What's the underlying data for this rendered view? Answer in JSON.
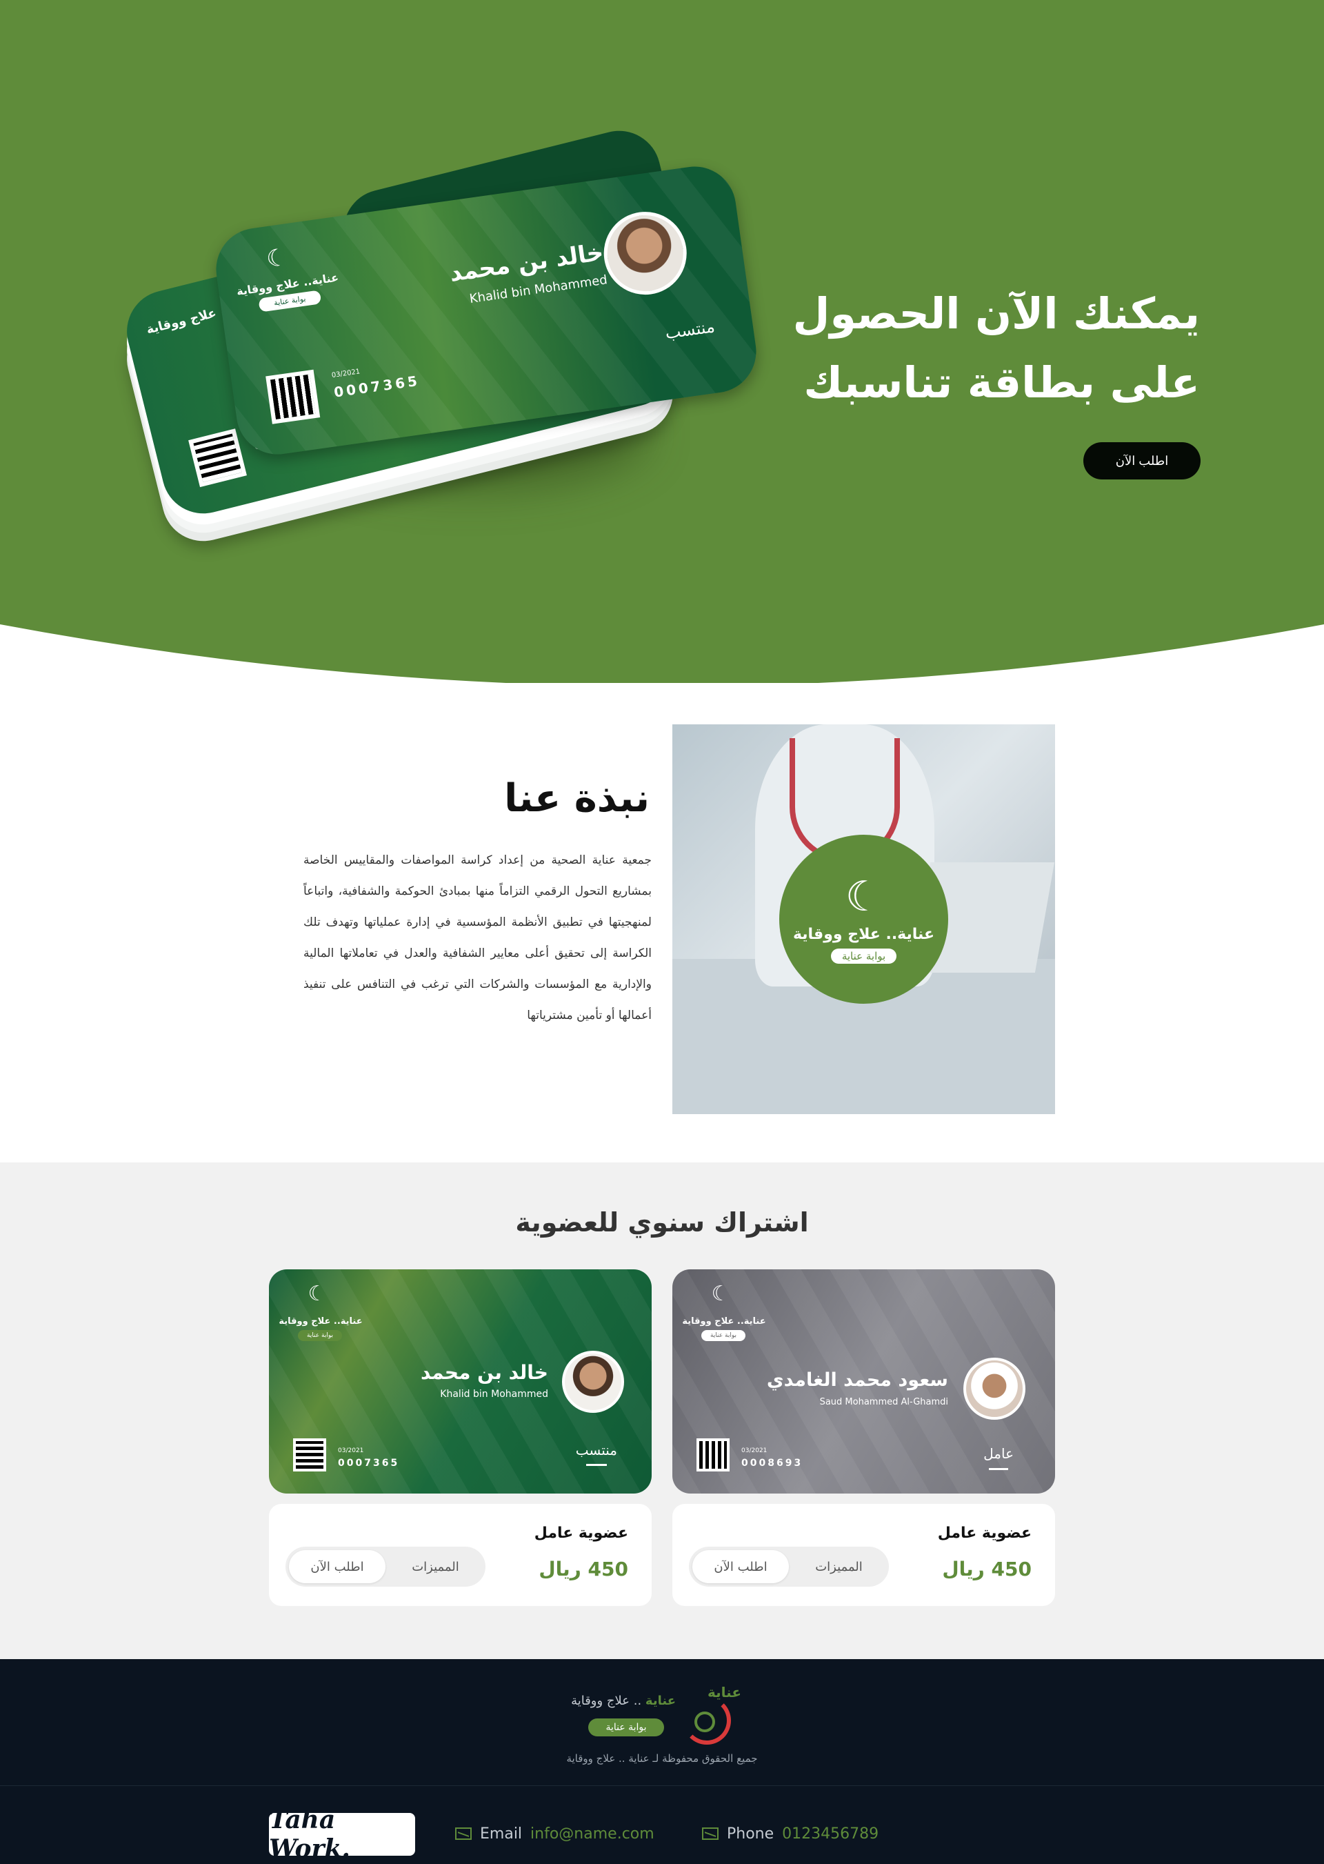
{
  "hero": {
    "title_line1": "يمكنك الآن الحصول",
    "title_line2": "على بطاقة تناسبك",
    "cta_label": "اطلب الآن"
  },
  "brand": {
    "name": "عناية",
    "tagline": "عناية.. علاج ووقاية",
    "portal": "بوابة عناية",
    "footer_name": "عناية",
    "footer_tagline": ".. علاج ووقاية",
    "copyright": "جميع الحقوق محفوظة لـ عناية .. علاج ووقاية"
  },
  "hero_card": {
    "name_ar": "خالد بن محمد",
    "name_en": "Khalid bin Mohammed",
    "member_type": "منتسب",
    "date": "03/2021",
    "number": "0007365",
    "number_partial": "0007"
  },
  "about": {
    "title": "نبذة عنا",
    "paragraph": "جمعية عناية الصحية من إعداد كراسة المواصفات والمقاييس الخاصة بمشاريع التحول الرقمي التزاماً منها بمبادئ الحوكمة والشفافية، واتباعاً لمنهجيتها في تطبيق الأنظمة المؤسسية في إدارة عملياتها وتهدف تلك الكراسة إلى تحقيق أعلى معايير الشفافية والعدل في تعاملاتها المالية والإدارية مع المؤسسات والشركات التي ترغب في التنافس على تنفيذ أعمالها أو تأمين مشترياتها"
  },
  "subscription": {
    "title": "اشتراك سنوي للعضوية",
    "plans": [
      {
        "card_name_ar": "سعود محمد الغامدي",
        "card_name_en": "Saud Mohammed Al-Ghamdi",
        "card_type": "عامل",
        "card_date": "03/2021",
        "card_number": "0008693",
        "plan_name": "عضوية عامل",
        "price": "450 ريال",
        "features_label": "المميزات",
        "order_label": "اطلب الآن",
        "theme": "#7a7a80"
      },
      {
        "card_name_ar": "خالد بن محمد",
        "card_name_en": "Khalid bin Mohammed",
        "card_type": "منتسب",
        "card_date": "03/2021",
        "card_number": "0007365",
        "plan_name": "عضوية عامل",
        "price": "450 ريال",
        "features_label": "المميزات",
        "order_label": "اطلب الآن",
        "theme": "#0f5a35"
      }
    ]
  },
  "footer": {
    "logo_text": "Taha Work.",
    "email_label": "Email",
    "email_value": "info@name.com",
    "phone_label": "Phone",
    "phone_value": "0123456789"
  },
  "colors": {
    "brand_green": "#5f8c3a",
    "card_green": "#0f5a35",
    "footer_bg": "#0b1420",
    "accent_red": "#d93a3a"
  }
}
